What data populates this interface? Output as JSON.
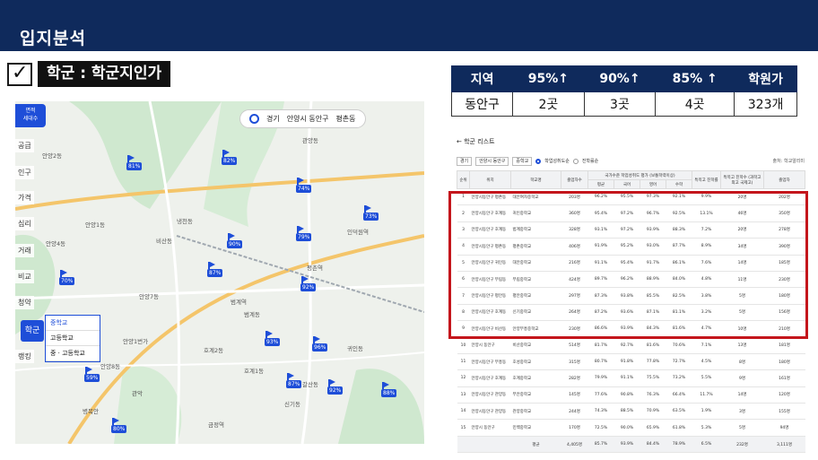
{
  "header": {
    "title": "입지분석"
  },
  "section": {
    "check": "✓",
    "title": "학군 : 학군지인가"
  },
  "summary": {
    "headers": [
      "지역",
      "95%↑",
      "90%↑",
      "85% ↑",
      "학원가"
    ],
    "row": [
      "동안구",
      "2곳",
      "3곳",
      "4곳",
      "323개"
    ]
  },
  "map": {
    "area_pill": [
      "면적",
      "세대수"
    ],
    "chip": {
      "a": "경기",
      "b": "안양시 동안구",
      "c": "평촌동"
    },
    "left_menu": [
      "공급",
      "인구",
      "가격",
      "심리",
      "거래",
      "비교",
      "청약",
      "학군",
      "랭킹"
    ],
    "school_menu": [
      "중학교",
      "고등학교",
      "중 · 고등학교"
    ],
    "labels": [
      "안양2동",
      "관양동",
      "안양1동",
      "안양4동",
      "비산동",
      "안양7동",
      "평촌역",
      "범계역",
      "호계2동",
      "관악",
      "금정역",
      "인덕원역",
      "호계1동",
      "갈산동",
      "신기동",
      "귀인동",
      "범계동",
      "안양8동",
      "안양1번가",
      "냉천동",
      "병목안"
    ],
    "pins": [
      "81%",
      "82%",
      "74%",
      "73%",
      "90%",
      "79%",
      "87%",
      "92%",
      "93%",
      "96%",
      "87%",
      "92%",
      "88%",
      "70%",
      "59%",
      "80%"
    ],
    "colors": {
      "accent": "#1e4ed8",
      "green": "#bfe3c4",
      "road": "#f4c56a"
    }
  },
  "list": {
    "title": "← 학군 리스트",
    "filters": {
      "region": "경기",
      "district": "안양시 동안구",
      "level": "중학교",
      "opt1": "학업성취도순",
      "opt2": "진학률순",
      "source": "출처: 학교알리미"
    },
    "headers": [
      "순위",
      "위치",
      "학교명",
      "졸업자수",
      "국가수준 학업성취도 평가 (보통학력이상)",
      "평균",
      "국어",
      "영어",
      "수학",
      "특목고 진학률",
      "특목고 진학수 (과학고 외고 국제고)",
      "졸업자"
    ],
    "rows": [
      [
        "1",
        "안양시동안구 평촌동",
        "대안여자중학교",
        "203명",
        "96.2%",
        "95.5%",
        "97.3%",
        "92.1%",
        "9.9%",
        "20명",
        "202명"
      ],
      [
        "2",
        "안양시동안구 호계동",
        "귀인중학교",
        "360명",
        "95.4%",
        "97.2%",
        "96.7%",
        "92.5%",
        "13.1%",
        "46명",
        "350명"
      ],
      [
        "3",
        "안양시동안구 호계동",
        "범계중학교",
        "328명",
        "93.1%",
        "97.2%",
        "93.9%",
        "88.3%",
        "7.2%",
        "20명",
        "278명"
      ],
      [
        "4",
        "안양시동안구 평촌동",
        "평촌중학교",
        "406명",
        "91.9%",
        "95.2%",
        "93.0%",
        "87.7%",
        "8.9%",
        "34명",
        "390명"
      ],
      [
        "5",
        "안양시동안구 귀인동",
        "대안중학교",
        "216명",
        "91.1%",
        "95.4%",
        "91.7%",
        "86.1%",
        "7.6%",
        "14명",
        "185명"
      ],
      [
        "6",
        "안양시동안구 부림동",
        "부림중학교",
        "424명",
        "89.7%",
        "96.2%",
        "88.9%",
        "84.0%",
        "4.8%",
        "11명",
        "230명"
      ],
      [
        "7",
        "안양시동안구 평안동",
        "평안중학교",
        "297명",
        "87.3%",
        "93.8%",
        "85.5%",
        "82.5%",
        "3.8%",
        "5명",
        "180명"
      ],
      [
        "8",
        "안양시동안구 호계동",
        "신기중학교",
        "264명",
        "87.2%",
        "93.6%",
        "87.1%",
        "81.1%",
        "3.2%",
        "5명",
        "156명"
      ],
      [
        "9",
        "안양시동안구 비산동",
        "안양부흥중학교",
        "230명",
        "86.6%",
        "93.9%",
        "84.3%",
        "81.6%",
        "4.7%",
        "10명",
        "210명"
      ],
      [
        "10",
        "안양시 동안구",
        "비산중학교",
        "514명",
        "81.7%",
        "92.7%",
        "81.6%",
        "70.6%",
        "7.1%",
        "13명",
        "181명"
      ],
      [
        "11",
        "안양시동안구 부흥동",
        "호성중학교",
        "315명",
        "80.7%",
        "91.8%",
        "77.8%",
        "72.7%",
        "4.5%",
        "8명",
        "180명"
      ],
      [
        "12",
        "안양시동안구 호계동",
        "호계중학교",
        "282명",
        "79.9%",
        "91.1%",
        "75.5%",
        "73.2%",
        "5.5%",
        "9명",
        "161명"
      ],
      [
        "13",
        "안양시동안구 관양동",
        "부안중학교",
        "145명",
        "77.6%",
        "90.8%",
        "76.3%",
        "66.4%",
        "11.7%",
        "14명",
        "120명"
      ],
      [
        "14",
        "안양시동안구 관양동",
        "관양중학교",
        "244명",
        "74.3%",
        "88.5%",
        "70.9%",
        "63.5%",
        "1.9%",
        "3명",
        "155명"
      ],
      [
        "15",
        "안양시 동안구",
        "민백중학교",
        "170명",
        "72.5%",
        "90.0%",
        "65.9%",
        "61.8%",
        "5.3%",
        "5명",
        "94명"
      ]
    ],
    "total": [
      "평균",
      "4,405명",
      "85.7%",
      "93.9%",
      "84.4%",
      "78.9%",
      "6.5%",
      "232명",
      "3,111명"
    ]
  }
}
